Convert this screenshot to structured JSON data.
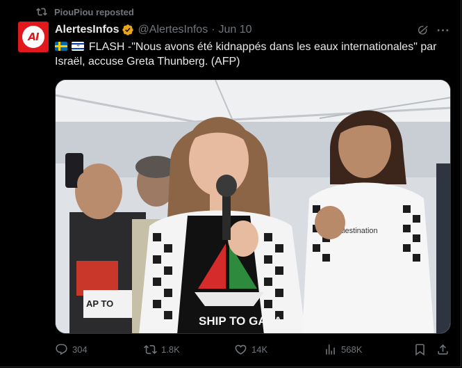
{
  "repost": {
    "label": "PiouPiou reposted",
    "icon": "repost-icon"
  },
  "author": {
    "display_name": "AlertesInfos",
    "handle": "@AlertesInfos",
    "separator": "·",
    "date": "Jun 10",
    "avatar_text": "AI",
    "avatar_color": "#e1191c",
    "verified_color": "#e8a617"
  },
  "post": {
    "flags": [
      "sweden-flag",
      "israel-flag"
    ],
    "text": "FLASH -\"Nous avons été kidnappés dans les eaux internationales\" par Israël, accuse Greta Thunberg. (AFP)",
    "image_text": {
      "shirt_slogan": "SHIP TO GAZA",
      "shirt2_text": "alestination",
      "shirt3_text": "AP TO"
    }
  },
  "actions": {
    "replies": "304",
    "reposts": "1.8K",
    "likes": "14K",
    "views": "568K"
  },
  "colors": {
    "background": "#000000",
    "text_primary": "#e7e9ea",
    "text_secondary": "#71767b",
    "border": "#2f3336"
  }
}
